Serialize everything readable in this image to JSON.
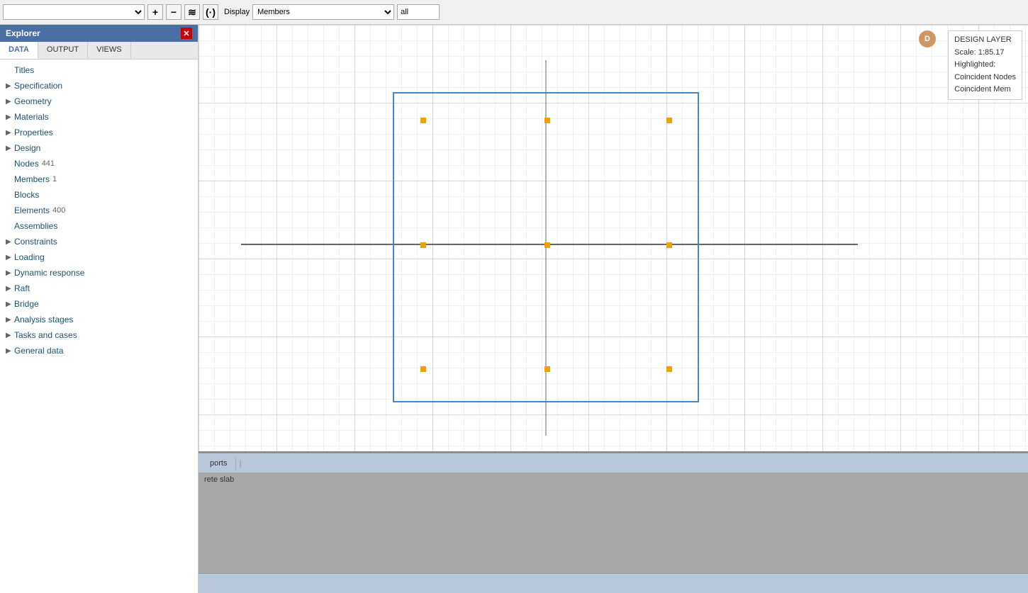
{
  "explorer": {
    "title": "Explorer",
    "tabs": [
      {
        "label": "DATA",
        "active": true
      },
      {
        "label": "OUTPUT",
        "active": false
      },
      {
        "label": "VIEWS",
        "active": false
      }
    ],
    "tree": [
      {
        "label": "Titles",
        "hasArrow": false,
        "indent": 0,
        "count": null
      },
      {
        "label": "Specification",
        "hasArrow": true,
        "indent": 0,
        "count": null
      },
      {
        "label": "Geometry",
        "hasArrow": true,
        "indent": 0,
        "count": null
      },
      {
        "label": "Materials",
        "hasArrow": true,
        "indent": 0,
        "count": null
      },
      {
        "label": "Properties",
        "hasArrow": true,
        "indent": 0,
        "count": null
      },
      {
        "label": "Design",
        "hasArrow": true,
        "indent": 0,
        "count": null
      },
      {
        "label": "Nodes",
        "hasArrow": false,
        "indent": 1,
        "count": "441"
      },
      {
        "label": "Members",
        "hasArrow": false,
        "indent": 1,
        "count": "1"
      },
      {
        "label": "Blocks",
        "hasArrow": false,
        "indent": 1,
        "count": null
      },
      {
        "label": "Elements",
        "hasArrow": false,
        "indent": 1,
        "count": "400"
      },
      {
        "label": "Assemblies",
        "hasArrow": false,
        "indent": 1,
        "count": null
      },
      {
        "label": "Constraints",
        "hasArrow": true,
        "indent": 0,
        "count": null
      },
      {
        "label": "Loading",
        "hasArrow": true,
        "indent": 0,
        "count": null
      },
      {
        "label": "Dynamic response",
        "hasArrow": true,
        "indent": 0,
        "count": null
      },
      {
        "label": "Raft",
        "hasArrow": true,
        "indent": 0,
        "count": null
      },
      {
        "label": "Bridge",
        "hasArrow": true,
        "indent": 0,
        "count": null
      },
      {
        "label": "Analysis stages",
        "hasArrow": true,
        "indent": 0,
        "count": null
      },
      {
        "label": "Tasks and cases",
        "hasArrow": true,
        "indent": 0,
        "count": null
      },
      {
        "label": "General data",
        "hasArrow": true,
        "indent": 0,
        "count": null
      }
    ]
  },
  "toolbar": {
    "display_label": "Display",
    "members_option": "Members",
    "all_value": "all",
    "add_icon": "+",
    "minus_icon": "−",
    "wave_icon": "≋",
    "radio_icon": "(·)"
  },
  "canvas": {
    "info": {
      "layer": "DESIGN LAYER",
      "scale": "Scale: 1:85.17",
      "highlighted": "Highlighted:",
      "coincident_nodes": "Coincident Nodes",
      "coincident_mem": "Coincident Mem"
    },
    "design_badge": "D"
  },
  "bottom": {
    "tabs": [
      "ports",
      "|"
    ],
    "content_text": "rete slab",
    "status_text": ""
  }
}
